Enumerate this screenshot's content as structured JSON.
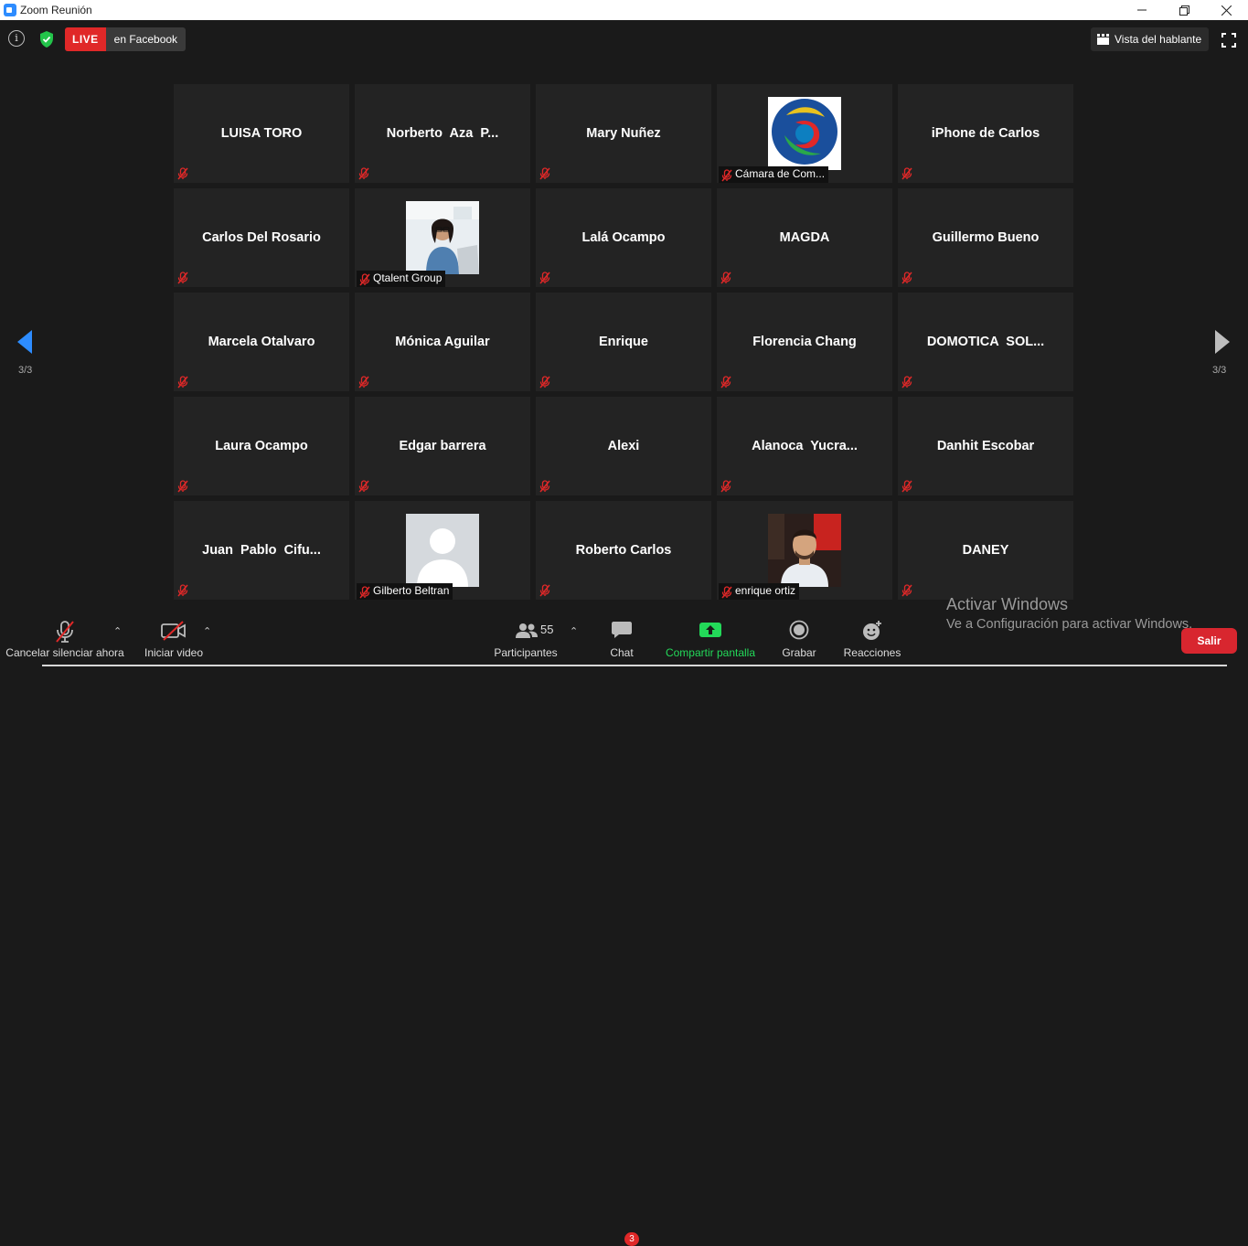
{
  "window": {
    "title": "Zoom Reunión",
    "controls": [
      "minimize",
      "restore",
      "close"
    ]
  },
  "topbar": {
    "live_tag": "LIVE",
    "live_destination": "en Facebook",
    "view_button": "Vista del hablante"
  },
  "navigation": {
    "page_left": "3/3",
    "page_right": "3/3"
  },
  "participants_grid": [
    {
      "name": "LUISA TORO",
      "muted": true
    },
    {
      "name": "Norberto  Aza  P...",
      "muted": true
    },
    {
      "name": "Mary Nuñez",
      "muted": true
    },
    {
      "name": "Cámara de Com...",
      "muted": true,
      "has_picture": true,
      "picture": "logo"
    },
    {
      "name": "iPhone de Carlos",
      "muted": true
    },
    {
      "name": "Carlos Del Rosario",
      "muted": true
    },
    {
      "name": "Qtalent Group",
      "muted": true,
      "has_picture": true,
      "picture": "woman-laptop"
    },
    {
      "name": "Lalá Ocampo",
      "muted": true
    },
    {
      "name": "MAGDA",
      "muted": true
    },
    {
      "name": "Guillermo Bueno",
      "muted": true
    },
    {
      "name": "Marcela Otalvaro",
      "muted": true
    },
    {
      "name": "Mónica Aguilar",
      "muted": true
    },
    {
      "name": "Enrique",
      "muted": true
    },
    {
      "name": "Florencia Chang",
      "muted": true
    },
    {
      "name": "DOMOTICA  SOL...",
      "muted": true
    },
    {
      "name": "Laura Ocampo",
      "muted": true
    },
    {
      "name": "Edgar barrera",
      "muted": true
    },
    {
      "name": "Alexi",
      "muted": true
    },
    {
      "name": "Alanoca  Yucra...",
      "muted": true
    },
    {
      "name": "Danhit Escobar",
      "muted": true
    },
    {
      "name": "Juan  Pablo  Cifu...",
      "muted": true
    },
    {
      "name": "Gilberto Beltran",
      "muted": true,
      "has_picture": true,
      "picture": "default-avatar"
    },
    {
      "name": "Roberto Carlos",
      "muted": true
    },
    {
      "name": "enrique ortiz",
      "muted": true,
      "has_picture": true,
      "picture": "man-photo"
    },
    {
      "name": "DANEY",
      "muted": true
    }
  ],
  "toolbar": {
    "unmute": "Cancelar silenciar ahora",
    "video": "Iniciar video",
    "participants": "Participantes",
    "participants_count": "55",
    "chat": "Chat",
    "chat_badge": "3",
    "share": "Compartir pantalla",
    "record": "Grabar",
    "reactions": "Reacciones",
    "exit": "Salir"
  },
  "watermark": {
    "line1": "Activar Windows",
    "line2": "Ve a Configuración para activar Windows."
  },
  "colors": {
    "background": "#1a1a1a",
    "tile": "#232323",
    "live_red": "#e02828",
    "share_green": "#23d959",
    "nav_blue": "#2d8cff",
    "exit_red": "#d8262f"
  }
}
